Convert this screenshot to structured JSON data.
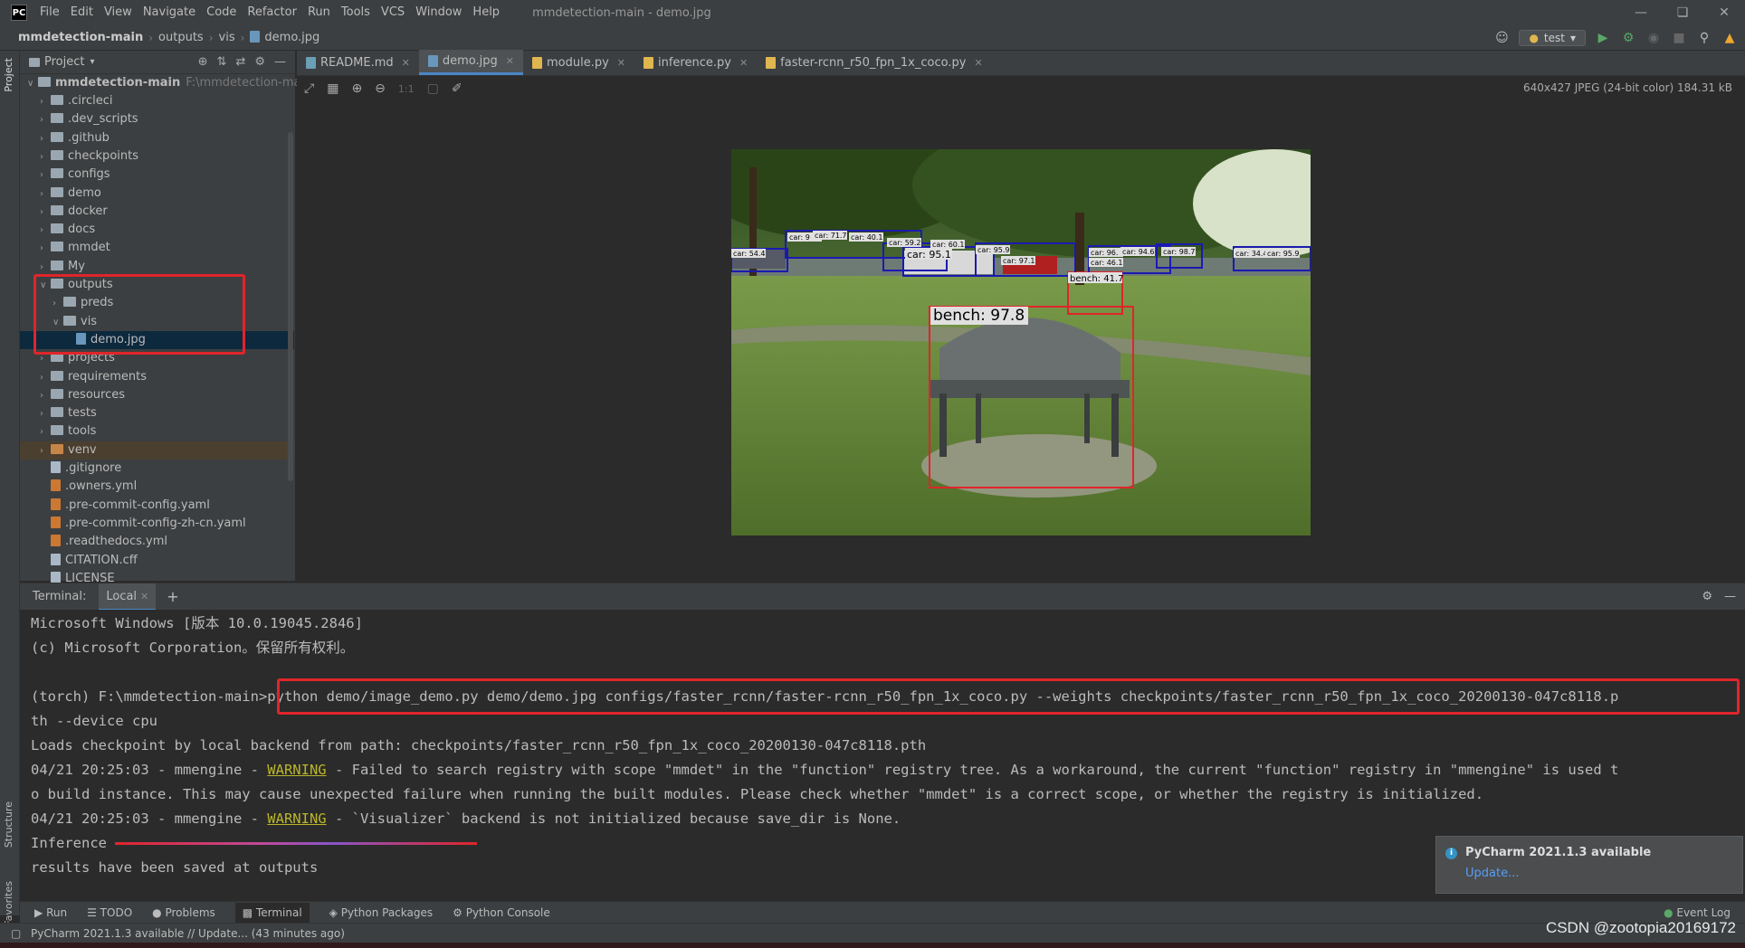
{
  "app": {
    "icon_label": "PC",
    "title": "mmdetection-main - demo.jpg",
    "menu": [
      "File",
      "Edit",
      "View",
      "Navigate",
      "Code",
      "Refactor",
      "Run",
      "Tools",
      "VCS",
      "Window",
      "Help"
    ]
  },
  "navbar": {
    "crumbs": [
      "mmdetection-main",
      "outputs",
      "vis",
      "demo.jpg"
    ],
    "run_config": "test"
  },
  "left_stripe": {
    "project": "Project",
    "structure": "Structure",
    "favorites": "Favorites"
  },
  "project": {
    "header": "Project",
    "root_label": "mmdetection-main",
    "root_path": "F:\\mmdetection-mai",
    "items": [
      {
        "label": ".circleci",
        "type": "folder"
      },
      {
        "label": ".dev_scripts",
        "type": "folder"
      },
      {
        "label": ".github",
        "type": "folder"
      },
      {
        "label": "checkpoints",
        "type": "folder"
      },
      {
        "label": "configs",
        "type": "folder"
      },
      {
        "label": "demo",
        "type": "folder"
      },
      {
        "label": "docker",
        "type": "folder"
      },
      {
        "label": "docs",
        "type": "folder"
      },
      {
        "label": "mmdet",
        "type": "folder"
      },
      {
        "label": "My",
        "type": "folder"
      },
      {
        "label": "outputs",
        "type": "folder"
      },
      {
        "label": "preds",
        "type": "folder"
      },
      {
        "label": "vis",
        "type": "folder"
      },
      {
        "label": "demo.jpg",
        "type": "image"
      },
      {
        "label": "projects",
        "type": "folder"
      },
      {
        "label": "requirements",
        "type": "folder"
      },
      {
        "label": "resources",
        "type": "folder"
      },
      {
        "label": "tests",
        "type": "folder"
      },
      {
        "label": "tools",
        "type": "folder"
      },
      {
        "label": "venv",
        "type": "folder"
      },
      {
        "label": ".gitignore",
        "type": "file"
      },
      {
        "label": ".owners.yml",
        "type": "yaml"
      },
      {
        "label": ".pre-commit-config.yaml",
        "type": "yaml"
      },
      {
        "label": ".pre-commit-config-zh-cn.yaml",
        "type": "yaml"
      },
      {
        "label": ".readthedocs.yml",
        "type": "yaml"
      },
      {
        "label": "CITATION.cff",
        "type": "file"
      },
      {
        "label": "LICENSE",
        "type": "file"
      }
    ]
  },
  "editor": {
    "tabs": [
      "README.md",
      "demo.jpg",
      "module.py",
      "inference.py",
      "faster-rcnn_r50_fpn_1x_coco.py"
    ],
    "active_tab": "demo.jpg",
    "zoom_label": "1:1",
    "image_info": "640x427 JPEG (24-bit color) 184.31 kB",
    "detections": {
      "bench_main": "bench: 97.8",
      "bench_small": "bench: 41.7",
      "cars": [
        "car: 54.4",
        "car: 9",
        "car: 71.7",
        "car: 40.1",
        "car: 59.2",
        "car: 60.1",
        "car: 95.1",
        "car: 95.9",
        "car: 97.1",
        "car: 96.",
        "car: 46.1",
        "car: 94.6",
        "car: 98.7",
        "car: 34.4",
        "car: 95.9"
      ]
    }
  },
  "terminal": {
    "label": "Terminal:",
    "tab": "Local",
    "lines": {
      "l1": "Microsoft Windows [版本 10.0.19045.2846]",
      "l2": "(c) Microsoft Corporation。保留所有权利。",
      "l3_prompt": "(torch) F:\\mmdetection-main>",
      "l3_cmd": "python demo/image_demo.py demo/demo.jpg configs/faster_rcnn/faster-rcnn_r50_fpn_1x_coco.py --weights checkpoints/faster_rcnn_r50_fpn_1x_coco_20200130-047c8118.p",
      "l4": "th --device cpu",
      "l5": "Loads checkpoint by local backend from path: checkpoints/faster_rcnn_r50_fpn_1x_coco_20200130-047c8118.pth",
      "l6_pre": "04/21 20:25:03 - mmengine - ",
      "l6_warn": "WARNING",
      "l6_post": " - Failed to search registry with scope \"mmdet\" in the \"function\" registry tree. As a workaround, the current \"function\" registry in \"mmengine\" is used t",
      "l7": "o build instance. This may cause unexpected failure when running the built modules. Please check whether \"mmdet\" is a correct scope, or whether the registry is initialized.",
      "l8_pre": "04/21 20:25:03 - mmengine - ",
      "l8_warn": "WARNING",
      "l8_post": " - `Visualizer` backend is not initialized because save_dir is None.",
      "l9": "Inference",
      "l10": "results have been saved at outputs"
    }
  },
  "notification": {
    "title": "PyCharm 2021.1.3 available",
    "link": "Update..."
  },
  "bottom_tabs": [
    "Run",
    "TODO",
    "Problems",
    "Terminal",
    "Python Packages",
    "Python Console"
  ],
  "event_log": "Event Log",
  "status": "PyCharm 2021.1.3 available // Update... (43 minutes ago)",
  "watermark": "CSDN @zootopia20169172",
  "colors": {
    "accent": "#4a88c7",
    "highlight_box": "#e0252b",
    "warning": "#bbb529"
  }
}
